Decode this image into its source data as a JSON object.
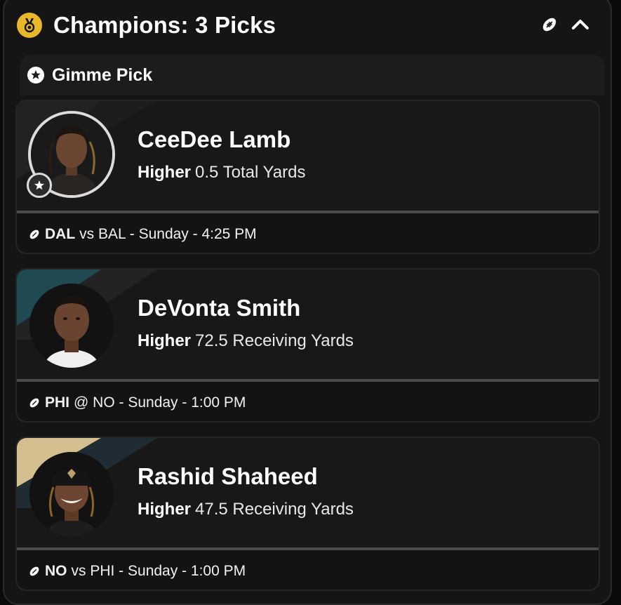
{
  "header": {
    "title": "Champions: 3 Picks"
  },
  "section": {
    "title": "Gimme Pick"
  },
  "colors": {
    "medal": "#e9b82a",
    "card_bg": "#161616",
    "eagles_teal": "#1f4a52",
    "saints_gold": "#d3bf8f"
  },
  "picks": [
    {
      "name": "CeeDee Lamb",
      "direction": "Higher",
      "line": "0.5 Total Yards",
      "team": "DAL",
      "matchup": "vs BAL - Sunday - 4:25 PM",
      "icon": "football-icon"
    },
    {
      "name": "DeVonta Smith",
      "direction": "Higher",
      "line": "72.5 Receiving Yards",
      "team": "PHI",
      "matchup": "@ NO - Sunday - 1:00 PM",
      "icon": "football-icon"
    },
    {
      "name": "Rashid Shaheed",
      "direction": "Higher",
      "line": "47.5 Receiving Yards",
      "team": "NO",
      "matchup": "vs PHI - Sunday - 1:00 PM",
      "icon": "football-icon"
    }
  ]
}
